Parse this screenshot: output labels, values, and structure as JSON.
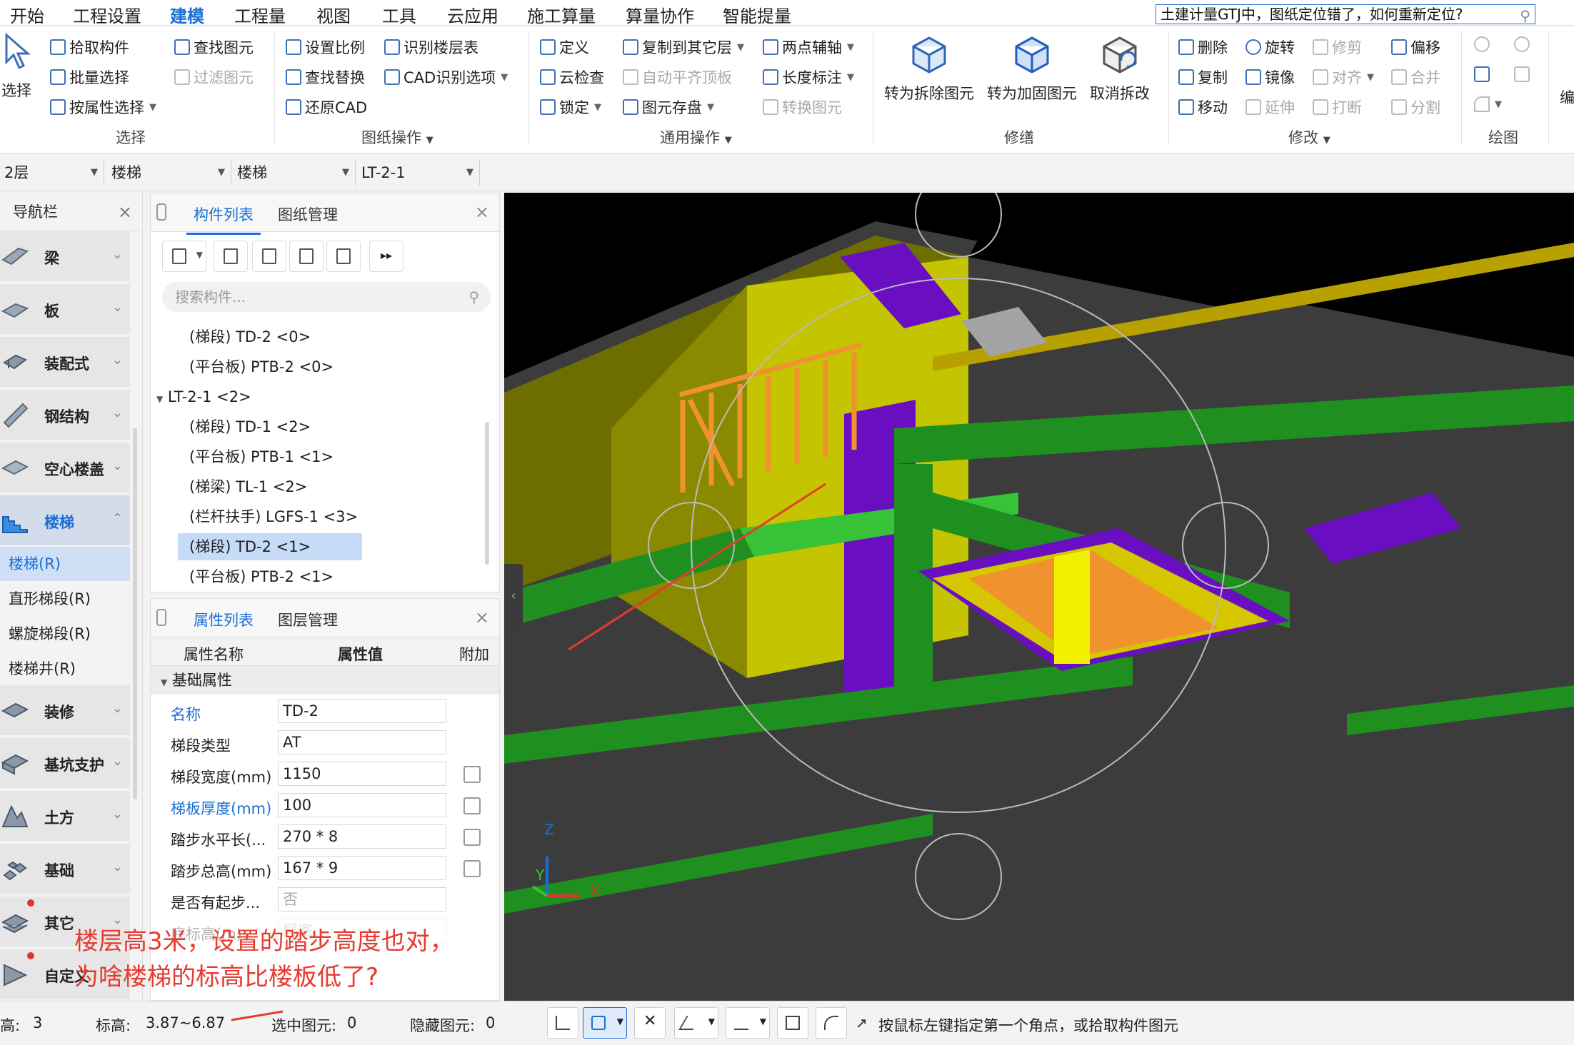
{
  "menubar": {
    "items": [
      "开始",
      "工程设置",
      "建模",
      "工程量",
      "视图",
      "工具",
      "云应用",
      "施工算量",
      "算量协作",
      "智能提量"
    ],
    "active_index": 2,
    "search_text": "土建计量GTJ中，图纸定位错了，如何重新定位?"
  },
  "ribbon": {
    "select_big": "选择",
    "select_group": {
      "pick": "拾取构件",
      "batch": "批量选择",
      "by_attr": "按属性选择",
      "find": "查找图元",
      "filter": "过滤图元",
      "label": "选择"
    },
    "drawing_group": {
      "scale": "设置比例",
      "find_replace": "查找替换",
      "restore_cad": "还原CAD",
      "identify_floor": "识别楼层表",
      "cad_options": "CAD识别选项",
      "label": "图纸操作"
    },
    "common_group": {
      "define": "定义",
      "cloud_check": "云检查",
      "lock": "锁定",
      "copy_floor": "复制到其它层",
      "auto_flush": "自动平齐顶板",
      "store": "图元存盘",
      "two_point_axis": "两点辅轴",
      "length_dim": "长度标注",
      "convert": "转换图元",
      "label": "通用操作"
    },
    "repair_group": {
      "to_remove": "转为拆除图元",
      "to_reinforce": "转为加固图元",
      "cancel": "取消拆改",
      "label": "修缮"
    },
    "modify_group": {
      "delete": "删除",
      "copy": "复制",
      "move": "移动",
      "rotate": "旋转",
      "mirror": "镜像",
      "extend": "延伸",
      "trim": "修剪",
      "align": "对齐",
      "break": "打断",
      "offset": "偏移",
      "merge": "合并",
      "split": "分割",
      "label": "修改"
    },
    "draw_group": {
      "label": "绘图"
    },
    "edge_cut_text": "编"
  },
  "selectors": [
    "2层",
    "楼梯",
    "楼梯",
    "LT-2-1"
  ],
  "nav": {
    "title": "导航栏",
    "items": [
      "梁",
      "板",
      "装配式",
      "钢结构",
      "空心楼盖",
      "楼梯",
      "装修",
      "基坑支护",
      "土方",
      "基础",
      "其它",
      "自定义"
    ],
    "active": "楼梯",
    "sub_items": [
      "楼梯(R)",
      "直形梯段(R)",
      "螺旋梯段(R)",
      "楼梯井(R)"
    ]
  },
  "component_panel": {
    "tabs": [
      "构件列表",
      "图纸管理"
    ],
    "search_placeholder": "搜索构件...",
    "tree": [
      {
        "text": "(梯段) TD-2 <0>",
        "level": 1
      },
      {
        "text": "(平台板) PTB-2 <0>",
        "level": 1
      },
      {
        "text": "LT-2-1 <2>",
        "level": 0
      },
      {
        "text": "(梯段) TD-1 <2>",
        "level": 1
      },
      {
        "text": "(平台板) PTB-1 <1>",
        "level": 1
      },
      {
        "text": "(梯梁) TL-1 <2>",
        "level": 1
      },
      {
        "text": "(栏杆扶手) LGFS-1 <3>",
        "level": 1
      },
      {
        "text": "(梯段) TD-2 <1>",
        "level": 1,
        "selected": true
      },
      {
        "text": "(平台板) PTB-2 <1>",
        "level": 1
      }
    ]
  },
  "property_panel": {
    "tabs": [
      "属性列表",
      "图层管理"
    ],
    "headers": [
      "属性名称",
      "属性值",
      "附加"
    ],
    "group": "基础属性",
    "rows": [
      {
        "name": "名称",
        "value": "TD-2",
        "link": true,
        "check": false
      },
      {
        "name": "梯段类型",
        "value": "AT",
        "link": false,
        "check": false
      },
      {
        "name": "梯段宽度(mm)",
        "value": "1150",
        "link": false,
        "check": true
      },
      {
        "name": "梯板厚度(mm)",
        "value": "100",
        "link": true,
        "check": true
      },
      {
        "name": "踏步水平长(...",
        "value": "270 * 8",
        "link": false,
        "check": true
      },
      {
        "name": "踏步总高(mm)",
        "value": "167 * 9",
        "link": false,
        "check": true
      },
      {
        "name": "是否有起步...",
        "value": "否",
        "link": false,
        "check": false,
        "grey": true
      },
      {
        "name": "底标高(m)",
        "value": "层底",
        "link": false,
        "check": false,
        "grey": true
      }
    ]
  },
  "status_bar": {
    "floor_height_label": "高:",
    "floor_height_value": "3",
    "elevation_label": "标高:",
    "elevation_value": "3.87~6.87",
    "selected_label": "选中图元:",
    "selected_value": "0",
    "hidden_label": "隐藏图元:",
    "hidden_value": "0",
    "hint": "按鼠标左键指定第一个角点，或拾取构件图元"
  },
  "annotation": {
    "line1": "楼层高3米，设置的踏步高度也对，",
    "line2": "为啥楼梯的标高比楼板低了?"
  },
  "axis_labels": {
    "x": "X",
    "y": "Y",
    "z": "Z"
  },
  "colors": {
    "accent": "#1a6fd6",
    "annotation_red": "#e63b2e",
    "slab_dark": "#3c3c3c",
    "wall_yellow": "#c8c800",
    "beam_green": "#1f8f1f",
    "column_purple": "#6a0ec2",
    "stair_orange": "#f0922e"
  }
}
